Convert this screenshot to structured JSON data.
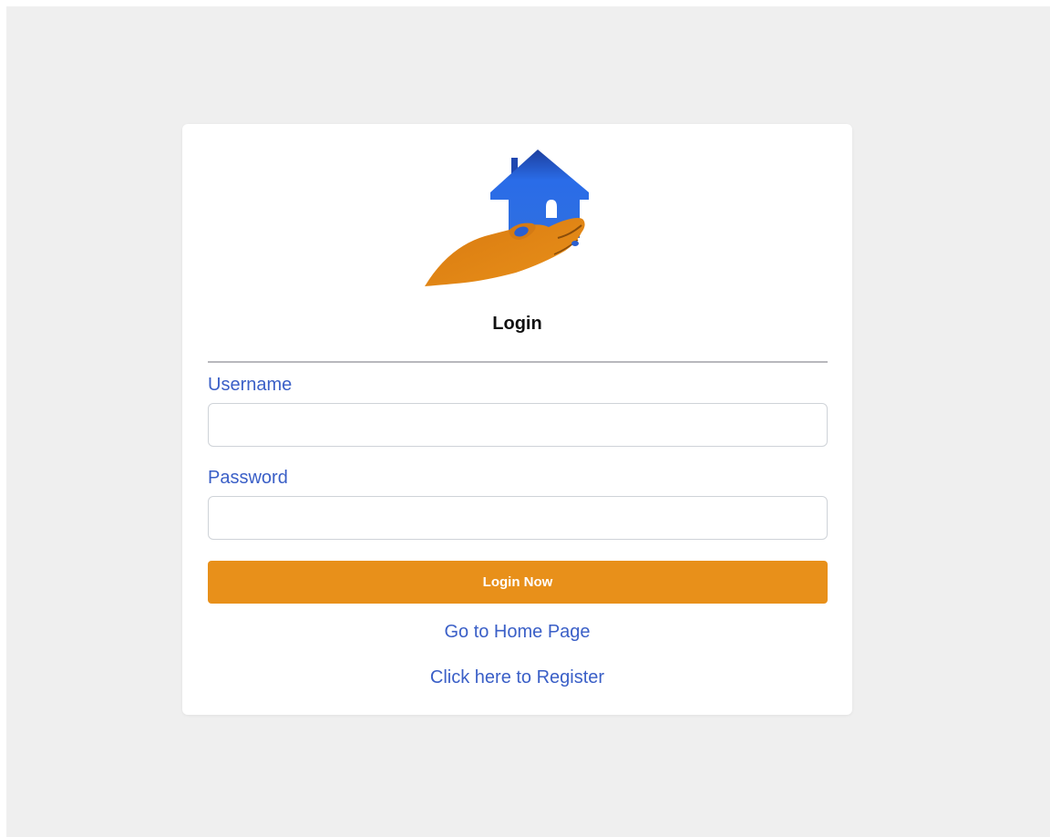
{
  "login": {
    "title": "Login",
    "username_label": "Username",
    "username_value": "",
    "password_label": "Password",
    "password_value": "",
    "submit_label": "Login Now",
    "home_link": "Go to Home Page",
    "register_link": "Click here to Register"
  },
  "colors": {
    "page_background": "#efefef",
    "card_background": "#ffffff",
    "accent": "#e8901a",
    "link": "#3a5fc7",
    "logo_house": "#2563d9",
    "logo_hand": "#e08a17"
  },
  "icons": {
    "logo": "house-in-hand-logo"
  }
}
